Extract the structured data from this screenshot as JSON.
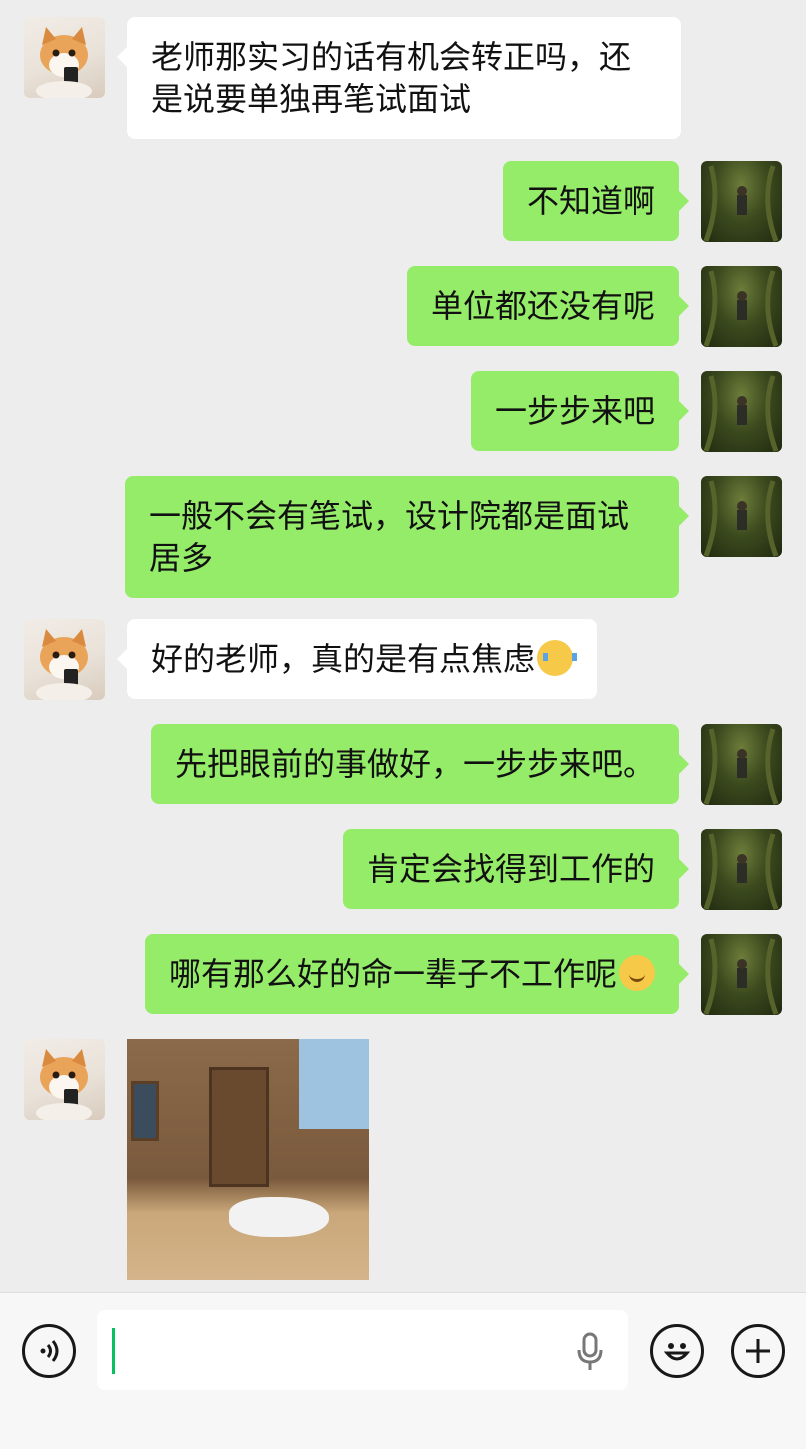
{
  "messages": [
    {
      "side": "left",
      "text": "老师那实习的话有机会转正吗，还是说要单独再笔试面试"
    },
    {
      "side": "right",
      "text": "不知道啊"
    },
    {
      "side": "right",
      "text": "单位都还没有呢"
    },
    {
      "side": "right",
      "text": "一步步来吧"
    },
    {
      "side": "right",
      "text": "一般不会有笔试，设计院都是面试居多"
    },
    {
      "side": "left",
      "text": "好的老师，真的是有点焦虑",
      "emoji": "crying-face"
    },
    {
      "side": "right",
      "text": "先把眼前的事做好，一步步来吧。"
    },
    {
      "side": "right",
      "text": "肯定会找得到工作的"
    },
    {
      "side": "right",
      "text": "哪有那么好的命一辈子不工作呢",
      "emoji": "smiling-face"
    },
    {
      "side": "left",
      "type": "sticker",
      "description": "cartoon bunny lying on ground in front of wooden house"
    }
  ],
  "input_bar": {
    "text_value": "",
    "icons": [
      "voice-icon",
      "mic-icon",
      "emoji-icon",
      "plus-icon"
    ]
  },
  "colors": {
    "background": "#ededed",
    "sent_bubble": "#95ec69",
    "received_bubble": "#ffffff",
    "caret": "#07c160"
  }
}
